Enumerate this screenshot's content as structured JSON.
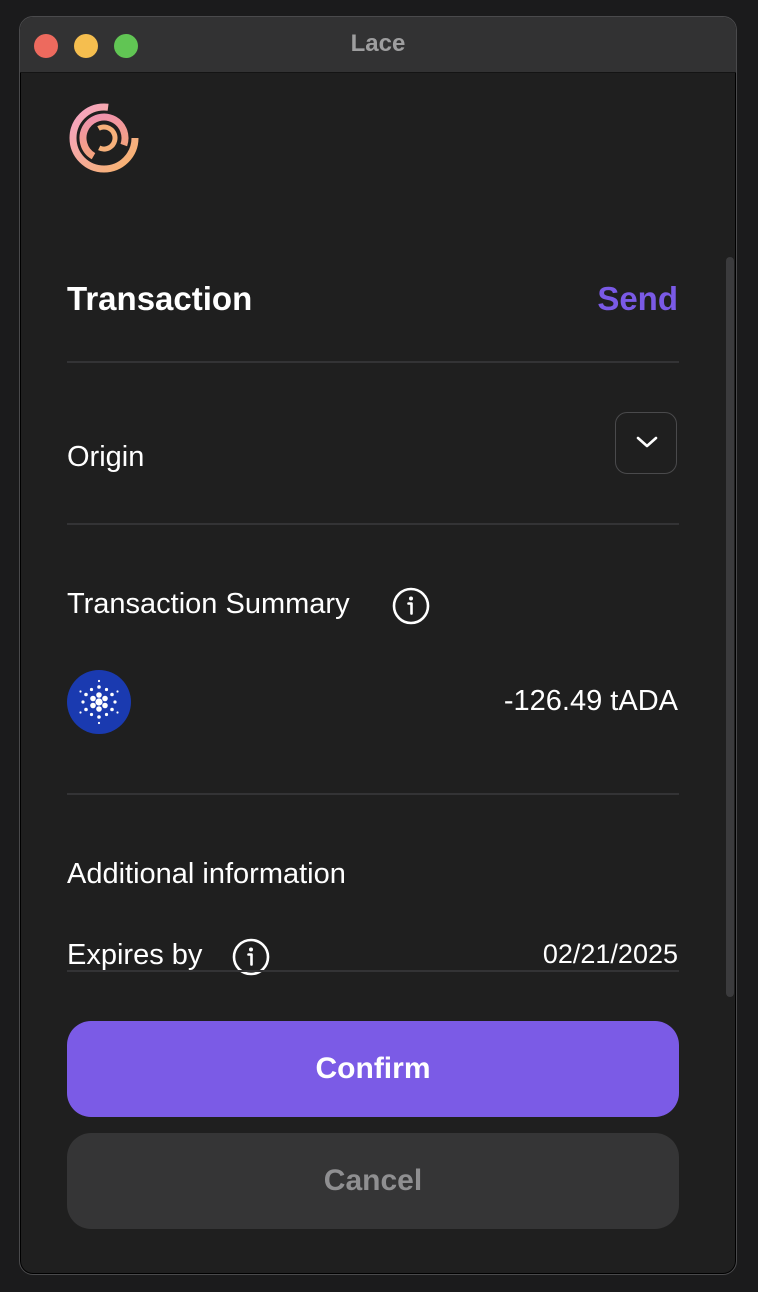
{
  "window": {
    "title": "Lace"
  },
  "header": {
    "logo_icon": "lace-logo-icon"
  },
  "transaction": {
    "title": "Transaction",
    "type": "Send"
  },
  "origin": {
    "label": "Origin",
    "toggle_icon": "chevron-down-icon"
  },
  "summary": {
    "title": "Transaction Summary",
    "info_icon": "info-icon",
    "asset_icon": "cardano-icon",
    "amount": "-126.49 tADA"
  },
  "additional": {
    "title": "Additional information",
    "expires_label": "Expires by",
    "expires_value": "02/21/2025"
  },
  "actions": {
    "confirm_label": "Confirm",
    "cancel_label": "Cancel"
  },
  "colors": {
    "accent": "#7b5be6",
    "background": "#1f1f1f",
    "titlebar": "#323233"
  }
}
